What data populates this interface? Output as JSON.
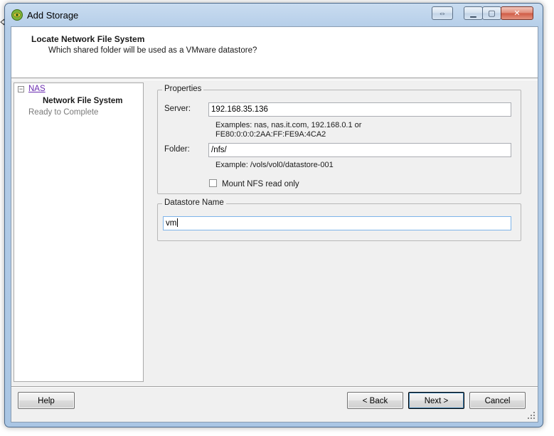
{
  "window": {
    "title": "Add Storage",
    "controls": {
      "restore_label": "⇔",
      "minimize_label": "▁",
      "maximize_label": "▢",
      "close_label": "✕"
    }
  },
  "header": {
    "title": "Locate Network File System",
    "subtitle": "Which shared folder will be used as a VMware datastore?"
  },
  "nav": {
    "collapse_symbol": "−",
    "root": "NAS",
    "current": "Network File System",
    "pending": "Ready to Complete"
  },
  "properties": {
    "legend": "Properties",
    "server_label": "Server:",
    "server_value": "192.168.35.136",
    "server_hint_line1": "Examples: nas, nas.it.com, 192.168.0.1 or",
    "server_hint_line2": "FE80:0:0:0:2AA:FF:FE9A:4CA2",
    "folder_label": "Folder:",
    "folder_value": "/nfs/",
    "folder_hint": "Example: /vols/vol0/datastore-001",
    "readonly_label": "Mount NFS read only",
    "readonly_checked": false
  },
  "datastore": {
    "legend": "Datastore Name",
    "name_value": "vm"
  },
  "buttons": {
    "help": "Help",
    "back": "< Back",
    "next": "Next >",
    "cancel": "Cancel"
  }
}
